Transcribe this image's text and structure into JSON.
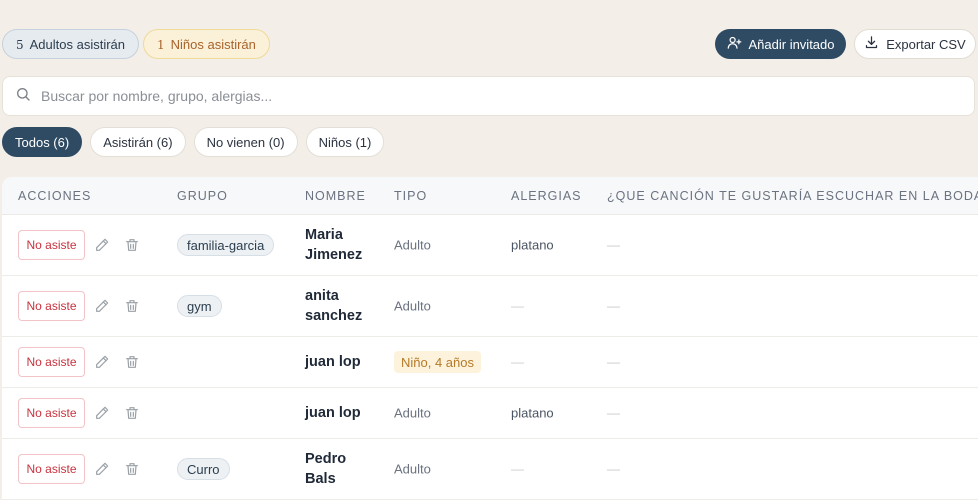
{
  "stats": {
    "adults_count": "5",
    "adults_label": "Adultos asistirán",
    "kids_count": "1",
    "kids_label": "Niños asistirán"
  },
  "actions": {
    "add_guest": "Añadir invitado",
    "export_csv": "Exportar CSV"
  },
  "search": {
    "placeholder": "Buscar por nombre, grupo, alergias..."
  },
  "filters": [
    {
      "label": "Todos (6)",
      "active": true
    },
    {
      "label": "Asistirán (6)",
      "active": false
    },
    {
      "label": "No vienen (0)",
      "active": false
    },
    {
      "label": "Niños (1)",
      "active": false
    }
  ],
  "table": {
    "headers": {
      "acciones": "ACCIONES",
      "grupo": "GRUPO",
      "nombre": "NOMBRE",
      "tipo": "TIPO",
      "alergias": "ALERGIAS",
      "cancion": "¿QUE CANCIÓN TE GUSTARÍA ESCUCHAR EN LA BODA?"
    },
    "no_asiste_label": "No asiste",
    "rows": [
      {
        "grupo": "familia-garcia",
        "nombre_1": "Maria",
        "nombre_2": "Jimenez",
        "tipo": "Adulto",
        "alergias": "platano",
        "cancion": "—"
      },
      {
        "grupo": "gym",
        "nombre_1": "anita",
        "nombre_2": "sanchez",
        "tipo": "Adulto",
        "alergias": "—",
        "cancion": "—"
      },
      {
        "grupo": "",
        "nombre_1": "juan lop",
        "nombre_2": "",
        "tipo": "Niño, 4 años",
        "alergias": "—",
        "cancion": "—"
      },
      {
        "grupo": "",
        "nombre_1": "juan lop",
        "nombre_2": "",
        "tipo": "Adulto",
        "alergias": "platano",
        "cancion": "—"
      },
      {
        "grupo": "Curro",
        "nombre_1": "Pedro",
        "nombre_2": "Bals",
        "tipo": "Adulto",
        "alergias": "—",
        "cancion": "—"
      }
    ]
  },
  "colors": {
    "background": "#f3efe8",
    "primary": "#2f4a63",
    "danger": "#c8323e",
    "kid_badge_bg": "#fdf3dc",
    "kid_badge_text": "#b57a28"
  },
  "icons": {
    "add_guest": "user-plus-icon",
    "export": "download-icon",
    "search": "search-icon",
    "edit": "pencil-icon",
    "delete": "trash-icon"
  }
}
